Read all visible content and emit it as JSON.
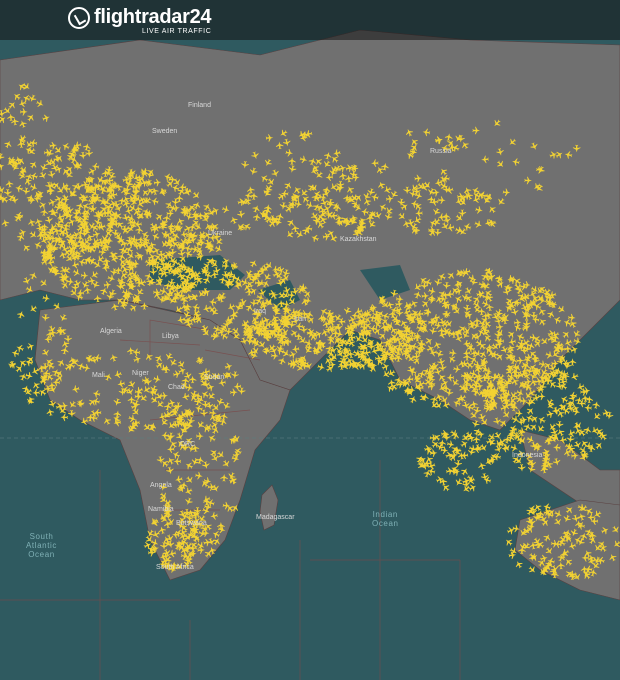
{
  "header": {
    "brand": "flightradar24",
    "tagline": "LIVE AIR TRAFFIC"
  },
  "countries": {
    "finland": "Finland",
    "sweden": "Sweden",
    "russia": "Russia",
    "ukraine": "Ukraine",
    "kazakhstan": "Kazakhstan",
    "algeria": "Algeria",
    "libya": "Libya",
    "mali": "Mali",
    "niger": "Niger",
    "chad": "Chad",
    "sudan": "Sudan",
    "iraq": "Iraq",
    "iran": "Iran",
    "drc": "DRC",
    "angola": "Angola",
    "namibia": "Namibia",
    "botswana": "Botswana",
    "south_africa": "South Africa",
    "madagascar": "Madagascar",
    "indonesia": "Indonesia"
  },
  "oceans": {
    "south_atlantic": "South\nAtlantic\nOcean",
    "indian": "Indian\nOcean"
  },
  "colors": {
    "ocean": "#2f5a60",
    "land": "#707070",
    "aircraft": "#f2d233",
    "border": "#5a4040"
  },
  "icons": {
    "logo": "radar-icon",
    "aircraft": "airplane-icon"
  }
}
